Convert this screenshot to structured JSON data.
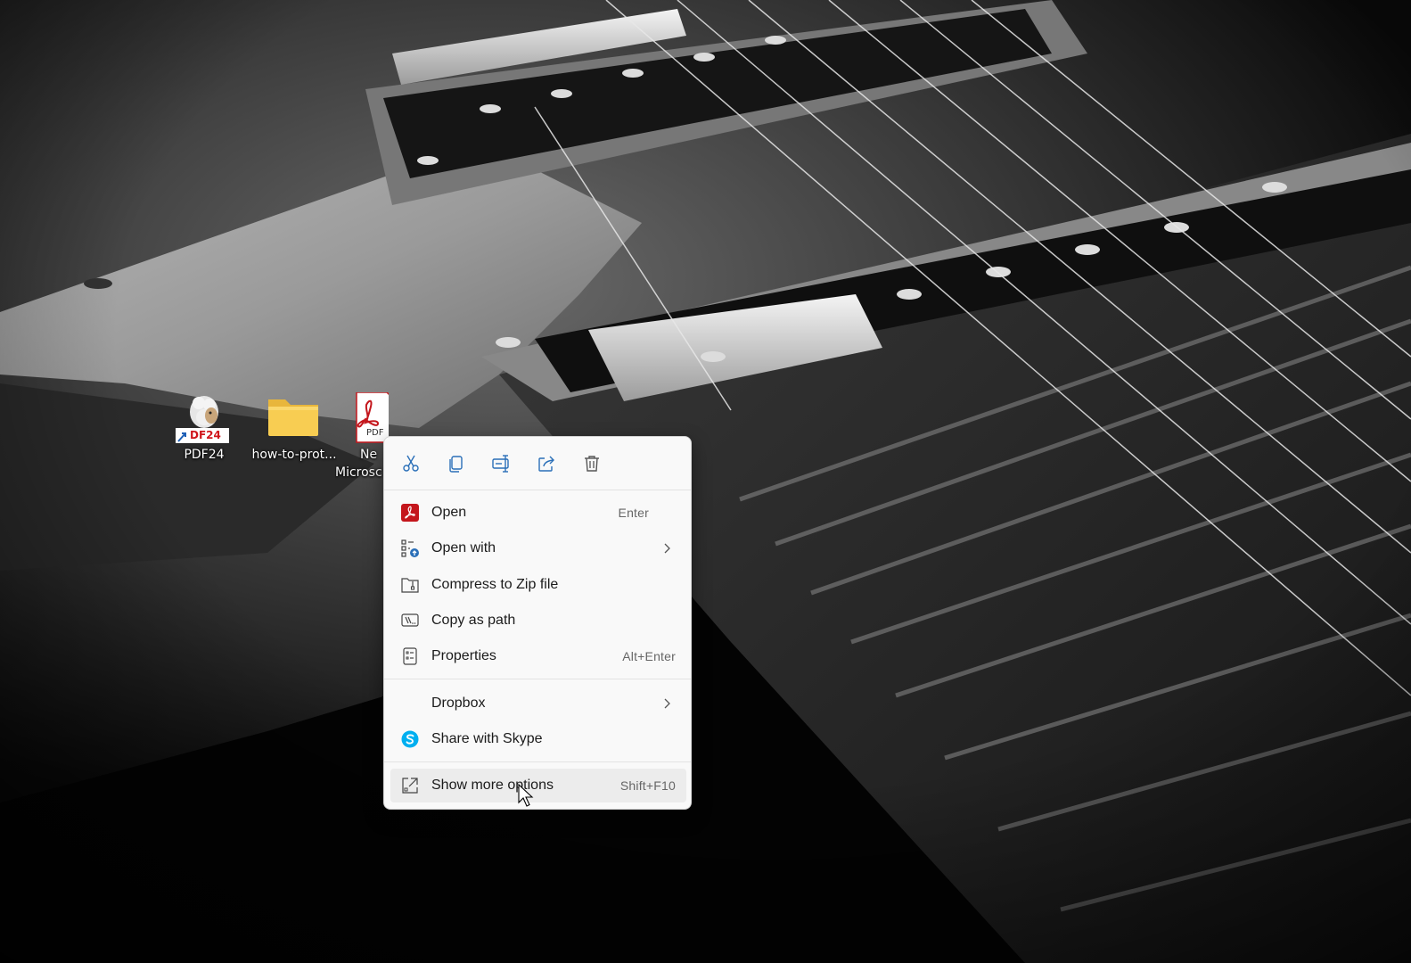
{
  "desktop": {
    "icons": [
      {
        "label": "PDF24",
        "icon": "pdf24-sheep-icon",
        "badge": "DF24"
      },
      {
        "label": "how-to-prot...",
        "icon": "folder-icon"
      },
      {
        "label": "Ne",
        "label2": "Microsc",
        "icon": "pdf-file-icon",
        "file_tag": "PDF"
      }
    ]
  },
  "context_menu": {
    "toolbar": [
      {
        "name": "cut",
        "icon": "scissors-icon"
      },
      {
        "name": "copy",
        "icon": "copy-icon"
      },
      {
        "name": "rename",
        "icon": "rename-icon"
      },
      {
        "name": "share",
        "icon": "share-icon"
      },
      {
        "name": "delete",
        "icon": "trash-icon"
      }
    ],
    "items": [
      {
        "label": "Open",
        "shortcut": "Enter",
        "icon": "acrobat-icon"
      },
      {
        "label": "Open with",
        "submenu": true,
        "icon": "open-with-icon"
      },
      {
        "label": "Compress to Zip file",
        "icon": "zip-folder-icon"
      },
      {
        "label": "Copy as path",
        "icon": "copy-path-icon"
      },
      {
        "label": "Properties",
        "shortcut": "Alt+Enter",
        "icon": "properties-icon"
      },
      {
        "label": "Dropbox",
        "submenu": true,
        "icon": ""
      },
      {
        "label": "Share with Skype",
        "icon": "skype-icon"
      },
      {
        "label": "Show more options",
        "shortcut": "Shift+F10",
        "icon": "show-more-icon"
      }
    ]
  },
  "colors": {
    "menu_bg": "#f9f9f9",
    "accent_blue": "#2a6fb8",
    "acrobat_red": "#c4161c",
    "skype_blue": "#00aff0",
    "folder_yellow": "#f8cd52"
  }
}
